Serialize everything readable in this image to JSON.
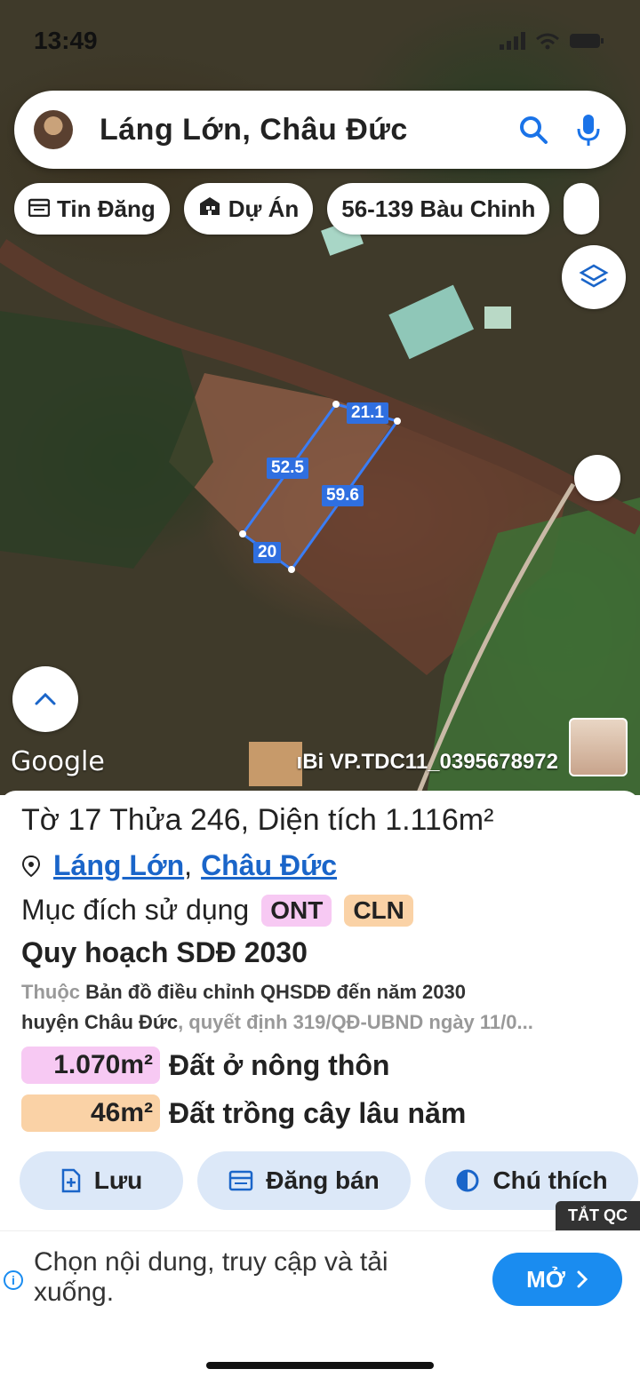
{
  "status_bar": {
    "time": "13:49"
  },
  "search": {
    "title": "Láng Lớn, Châu Đức",
    "search_icon": "search-icon",
    "mic_icon": "microphone-icon"
  },
  "chips": [
    {
      "label": "Tin Đăng",
      "icon": "calendar-icon"
    },
    {
      "label": "Dự Án",
      "icon": "building-icon"
    },
    {
      "label": "56-139 Bàu Chinh",
      "icon": ""
    }
  ],
  "map": {
    "google_label": "Google",
    "credit": "ıBi VP.TDC11_0395678972",
    "measurements": {
      "top": "21.1",
      "left": "52.5",
      "right": "59.6",
      "bottom": "20"
    }
  },
  "parcel": {
    "title": "Tờ 17 Thửa 246, Diện tích 1.116m²",
    "location_ward": "Láng Lớn",
    "location_sep": ",",
    "location_district": "Châu Đức",
    "purpose_label": "Mục đích sử dụng",
    "purpose_tags": [
      "ONT",
      "CLN"
    ],
    "plan_title": "Quy hoạch SDĐ 2030",
    "plan_prefix": "Thuộc",
    "plan_map": "Bản đồ điều chỉnh QHSDĐ đến năm 2030",
    "plan_map2": "huyện Châu Đức",
    "plan_decision": ", quyết định 319/QĐ-UBND ngày 11/0...",
    "areas": [
      {
        "value": "1.070m²",
        "label": "Đất ở nông thôn",
        "color": "#f7c9f3"
      },
      {
        "value": "46m²",
        "label": "Đất trồng cây lâu năm",
        "color": "#fad2a6"
      }
    ],
    "tag_colors": {
      "ONT": "#f7c9f3",
      "CLN": "#fad2a6"
    }
  },
  "actions": {
    "save": "Lưu",
    "post": "Đăng bán",
    "legend": "Chú thích"
  },
  "ad": {
    "tag": "TẮT QC",
    "text": "Chọn nội dung, truy cập và tải xuống.",
    "button": "MỞ"
  },
  "colors": {
    "accent": "#1a65c9",
    "action_bg": "#dce8f8",
    "measure": "#2f6fe0"
  }
}
